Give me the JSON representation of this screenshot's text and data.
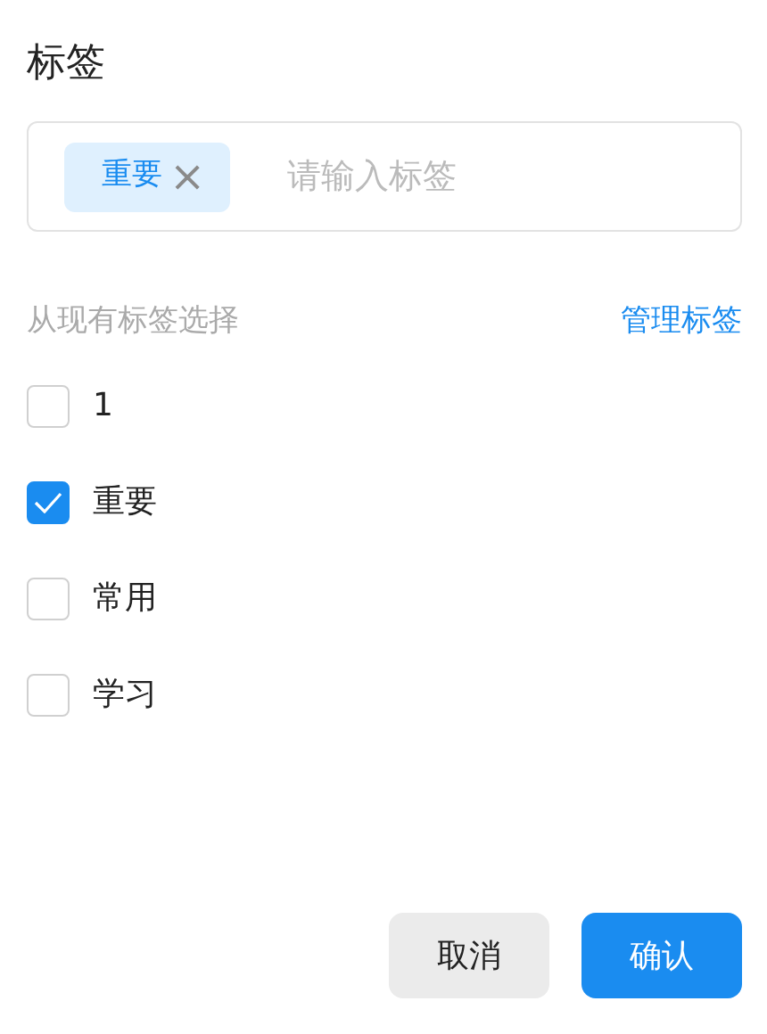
{
  "title": "标签",
  "input": {
    "tags": [
      {
        "label": "重要",
        "remove": "×"
      }
    ],
    "placeholder": "请输入标签"
  },
  "section": {
    "label": "从现有标签选择",
    "link": "管理标签"
  },
  "options": [
    {
      "label": "1",
      "checked": false
    },
    {
      "label": "重要",
      "checked": true
    },
    {
      "label": "常用",
      "checked": false
    },
    {
      "label": "学习",
      "checked": false
    }
  ],
  "buttons": [
    {
      "label": "取消",
      "kind": "secondary"
    },
    {
      "label": "确认",
      "kind": "primary"
    }
  ]
}
